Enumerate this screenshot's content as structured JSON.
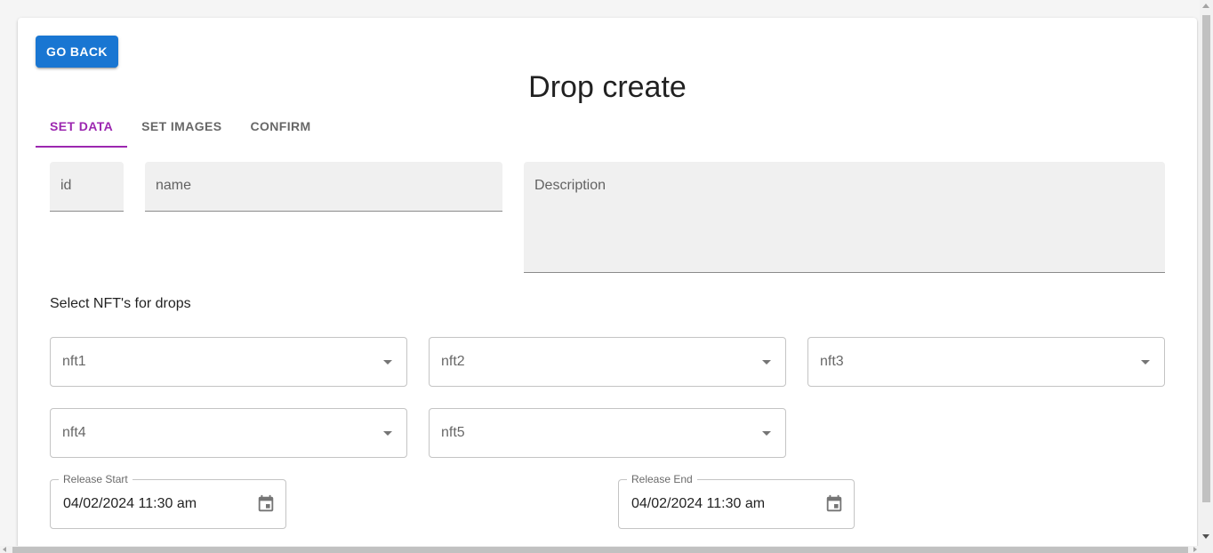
{
  "colors": {
    "primary": "#1976d2",
    "accent": "#9c27b0"
  },
  "header": {
    "back_label": "GO BACK",
    "title": "Drop create"
  },
  "tabs": [
    {
      "label": "SET DATA",
      "active": true
    },
    {
      "label": "SET IMAGES",
      "active": false
    },
    {
      "label": "CONFIRM",
      "active": false
    }
  ],
  "form": {
    "id_placeholder": "id",
    "name_placeholder": "name",
    "description_placeholder": "Description",
    "nft_section_label": "Select NFT's for drops",
    "nft_selects": [
      "nft1",
      "nft2",
      "nft3",
      "nft4",
      "nft5"
    ],
    "release_start": {
      "label": "Release Start",
      "value": "04/02/2024 11:30 am",
      "icon": "calendar-icon"
    },
    "release_end": {
      "label": "Release End",
      "value": "04/02/2024 11:30 am",
      "icon": "calendar-icon"
    }
  }
}
